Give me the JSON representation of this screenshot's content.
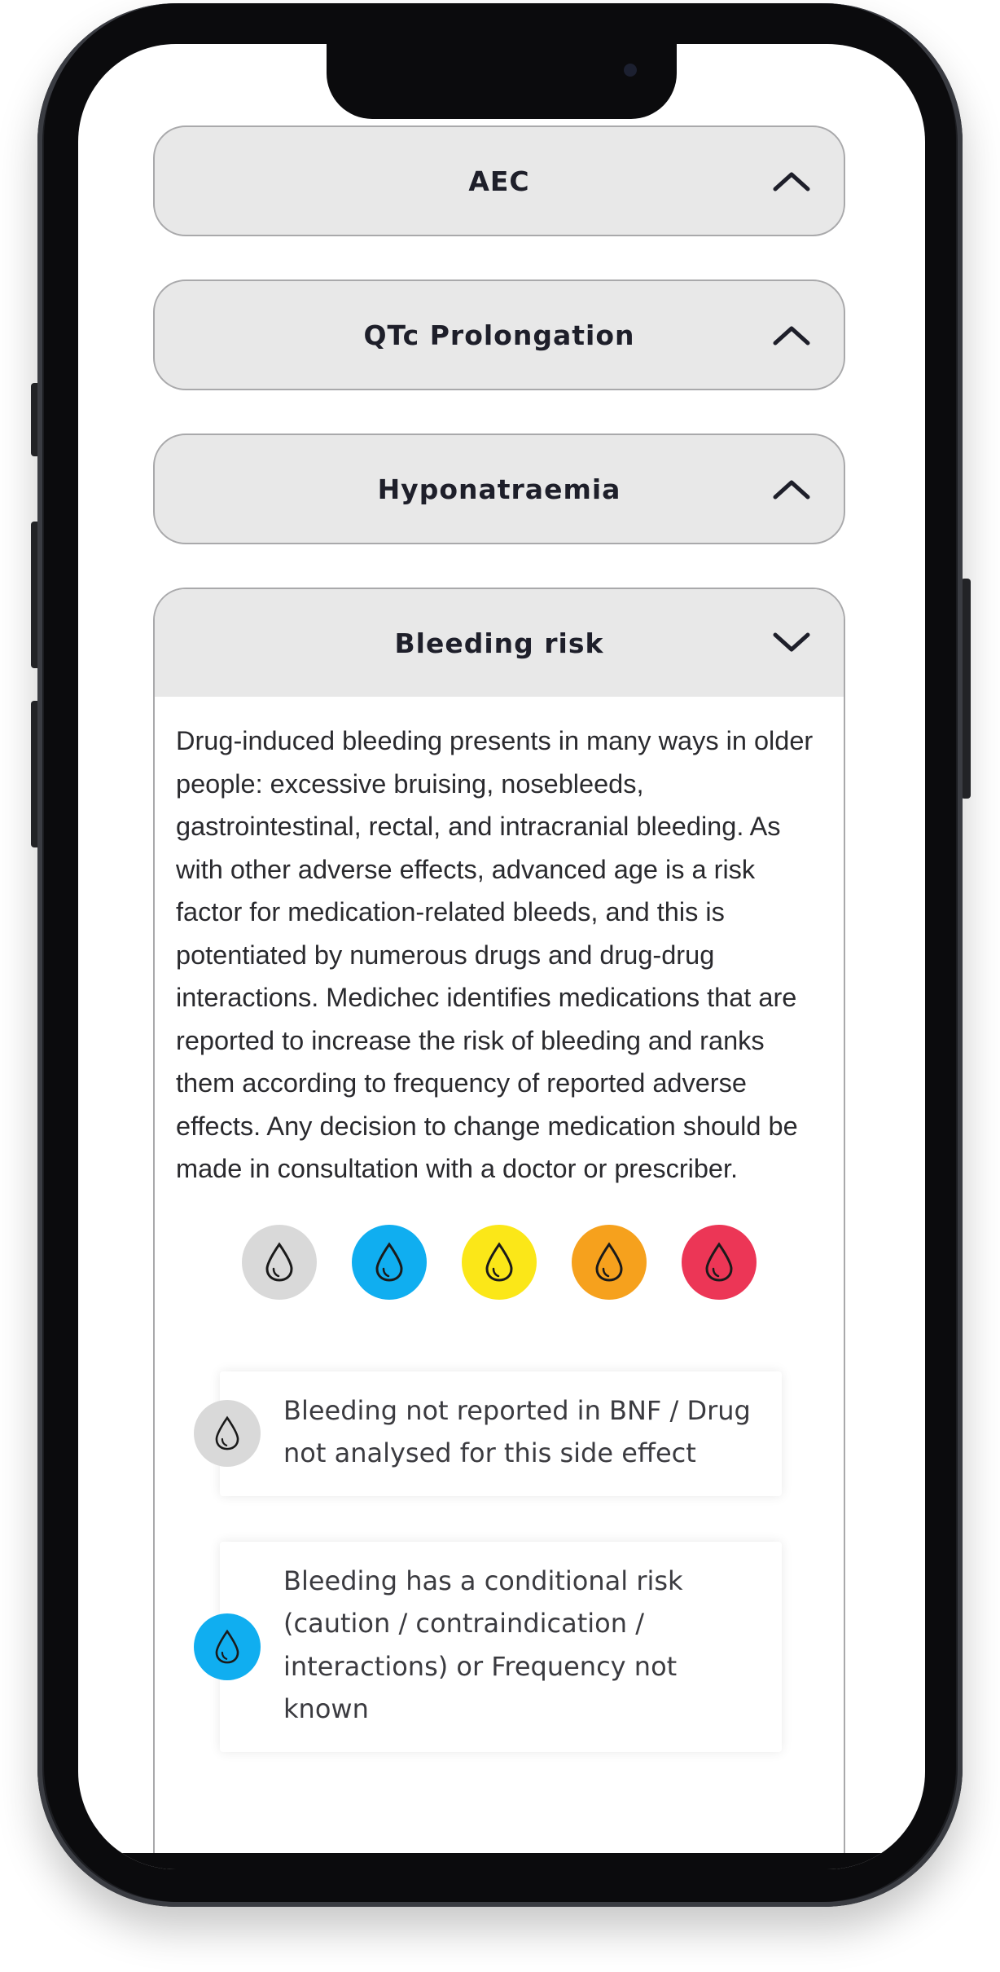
{
  "accordions": [
    {
      "title": "AEC",
      "state": "collapsed",
      "chevron_icon": "chevron-up-icon"
    },
    {
      "title": "QTc Prolongation",
      "state": "collapsed",
      "chevron_icon": "chevron-up-icon"
    },
    {
      "title": "Hyponatraemia",
      "state": "collapsed",
      "chevron_icon": "chevron-up-icon"
    },
    {
      "title": "Bleeding risk",
      "state": "expanded",
      "chevron_icon": "chevron-down-icon",
      "description": "Drug-induced bleeding presents in many ways in older people: excessive bruising, nosebleeds, gastrointestinal, rectal, and intracranial bleeding. As with other adverse effects, advanced age is a risk factor for medication-related bleeds, and this is potentiated by numerous drugs and drug-drug interactions. Medichec identifies medications that are reported to increase the risk of bleeding and ranks them according to frequency of reported adverse effects. Any decision to change medication should be made in consultation with a doctor or prescriber.",
      "risk_levels": [
        {
          "name": "grey",
          "color": "#d9d9d9",
          "icon": "blood-drop-icon"
        },
        {
          "name": "blue",
          "color": "#10aef0",
          "icon": "blood-drop-icon"
        },
        {
          "name": "yellow",
          "color": "#fbe718",
          "icon": "blood-drop-icon"
        },
        {
          "name": "orange",
          "color": "#f6a11d",
          "icon": "blood-drop-icon"
        },
        {
          "name": "red",
          "color": "#ec3656",
          "icon": "blood-drop-icon"
        }
      ],
      "legend": [
        {
          "color": "#d9d9d9",
          "text": "Bleeding not reported in BNF / Drug not analysed for this side effect"
        },
        {
          "color": "#10aef0",
          "text": "Bleeding has a conditional risk (caution / contraindication / interactions) or Frequency not known"
        }
      ]
    }
  ],
  "colors": {
    "header_bg": "#e8e8e8",
    "border": "#a9a9ab",
    "title_text": "#1e1f2a",
    "body_text": "#2a2a2e"
  }
}
